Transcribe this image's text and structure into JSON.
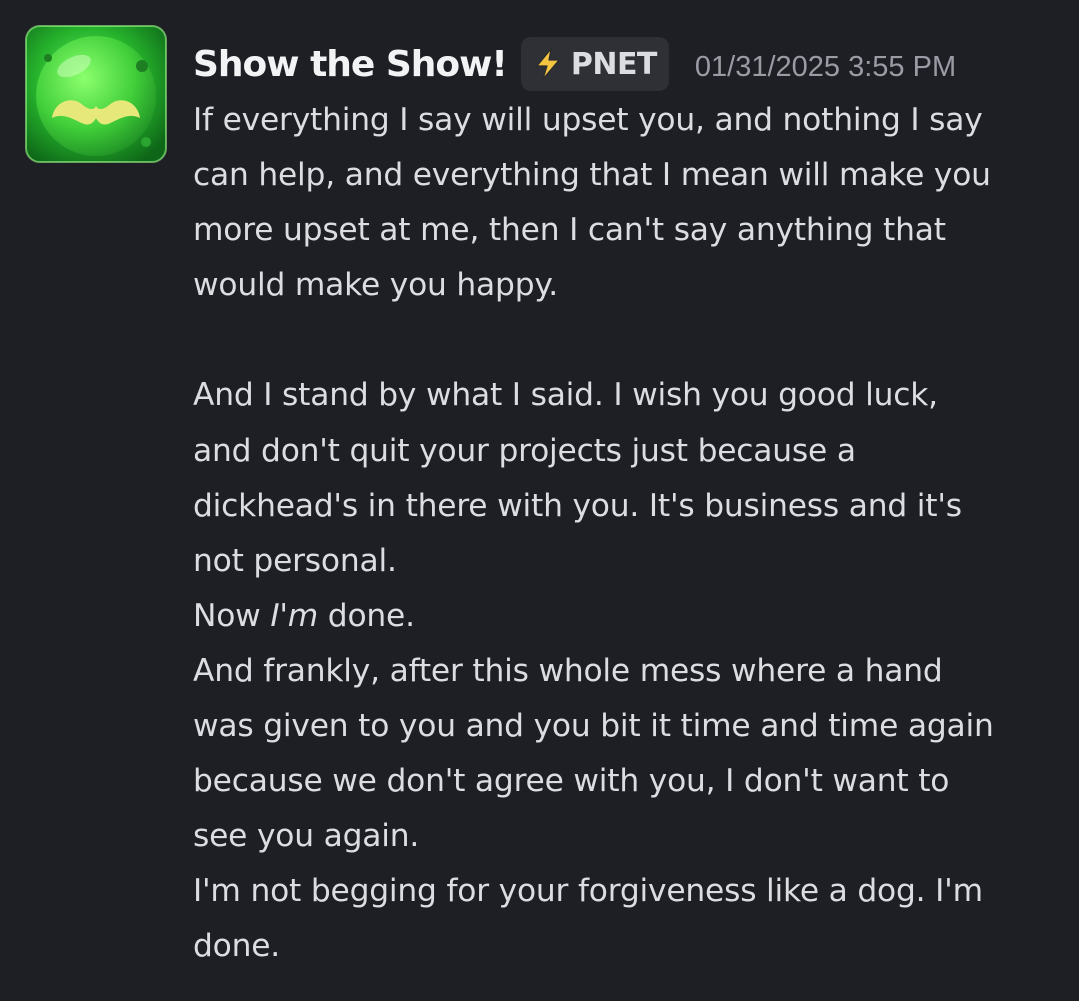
{
  "message": {
    "author": "Show the Show!",
    "tag": {
      "icon": "lightning-bolt-icon",
      "label": "PNET"
    },
    "timestamp": "01/31/2025 3:55 PM",
    "avatar": {
      "icon": "green-jelly-cube-mustache-icon"
    },
    "lines": {
      "l1": "If everything I say will upset you, and nothing I say",
      "l2": "can help, and everything that I mean will make you",
      "l3": "more upset at me, then I can't say anything that",
      "l4": "would make you happy.",
      "l5": "And I stand by what I said. I wish you good luck,",
      "l6": "and don't quit your projects just because a",
      "l7": "dickhead's in there with you. It's business and it's",
      "l8": "not personal.",
      "l9_prefix": "Now ",
      "l9_emphasis": "I'm",
      "l9_suffix": " done.",
      "l10": "And frankly, after this whole mess where a hand",
      "l11": "was given to you and you bit it time and time again",
      "l12": "because we don't agree with you, I don't want to",
      "l13": "see you again.",
      "l14": "I'm not begging for your forgiveness like a dog. I'm",
      "l15": "done."
    }
  },
  "colors": {
    "background": "#1e1f24",
    "author": "#f2f3f5",
    "text": "#dcdde1",
    "timestamp": "#9a9ca5",
    "tag_background": "#2e3035",
    "avatar_green": "#3fd14a",
    "bolt_yellow": "#f5c542"
  }
}
